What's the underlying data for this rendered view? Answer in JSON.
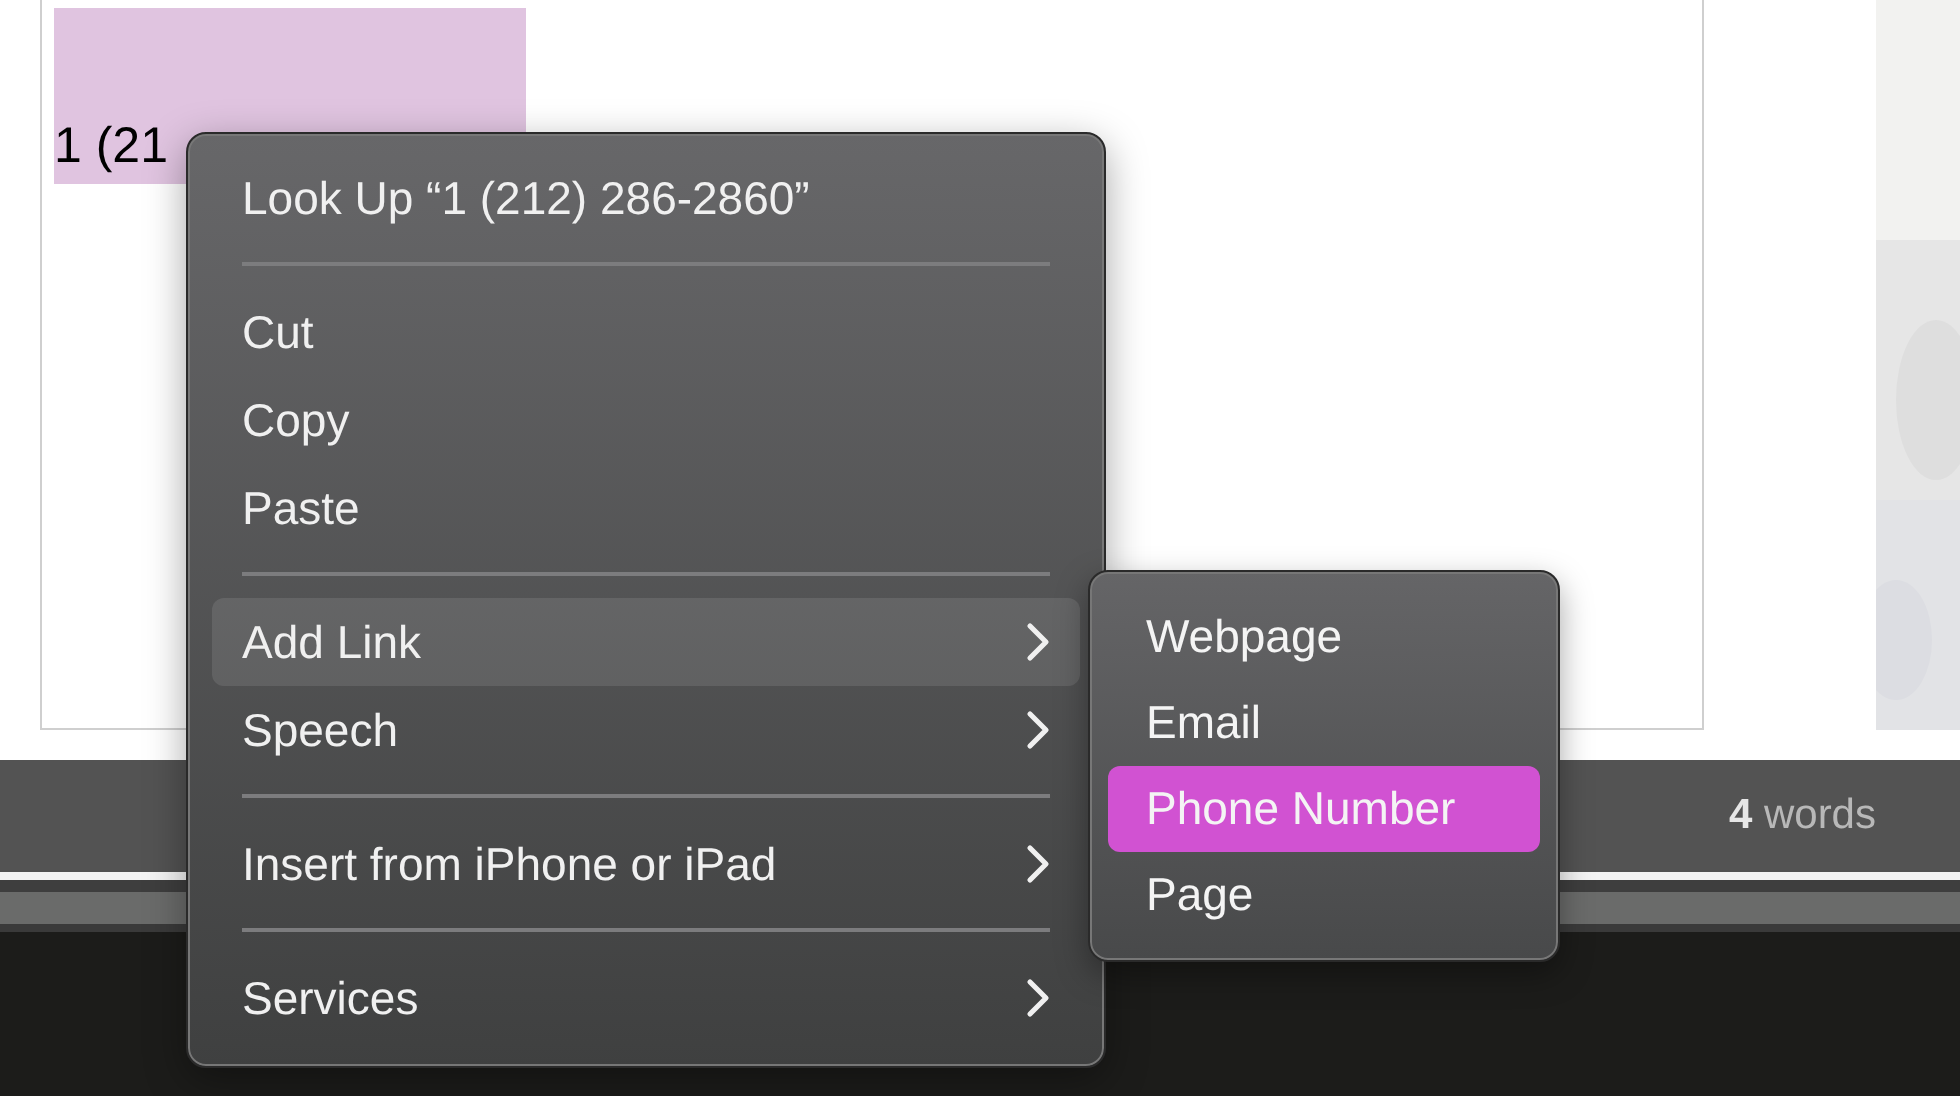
{
  "document": {
    "selected_text": "1 (21"
  },
  "status_bar": {
    "count": "4",
    "label": "words"
  },
  "context_menu": {
    "sections": [
      [
        {
          "label": "Look Up “1 (212) 286-2860”",
          "submenu": false,
          "selected": false
        }
      ],
      [
        {
          "label": "Cut",
          "submenu": false,
          "selected": false
        },
        {
          "label": "Copy",
          "submenu": false,
          "selected": false
        },
        {
          "label": "Paste",
          "submenu": false,
          "selected": false
        }
      ],
      [
        {
          "label": "Add Link",
          "submenu": true,
          "selected": true
        },
        {
          "label": "Speech",
          "submenu": true,
          "selected": false
        }
      ],
      [
        {
          "label": "Insert from iPhone or iPad",
          "submenu": true,
          "selected": false
        }
      ],
      [
        {
          "label": "Services",
          "submenu": true,
          "selected": false
        }
      ]
    ]
  },
  "submenu": {
    "items": [
      {
        "label": "Webpage",
        "selected": false
      },
      {
        "label": "Email",
        "selected": false
      },
      {
        "label": "Phone Number",
        "selected": true
      },
      {
        "label": "Page",
        "selected": false
      }
    ]
  }
}
